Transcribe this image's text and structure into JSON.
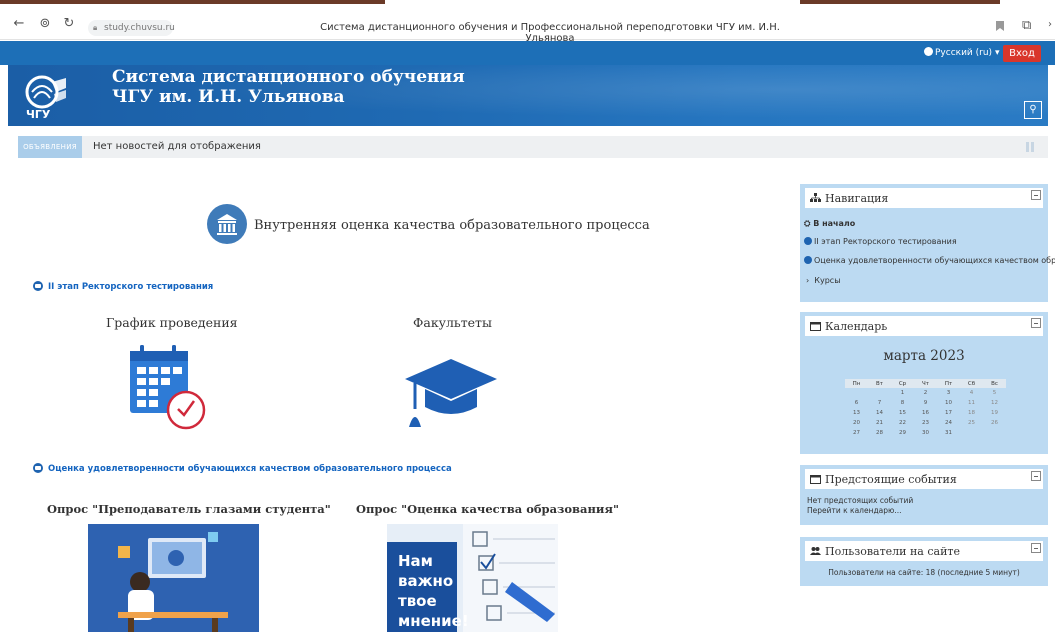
{
  "browser": {
    "url": "study.chuvsu.ru",
    "tab_title": "Система дистанционного обучения и Профессиональной переподготовки ЧГУ им. И.Н. Ульянова"
  },
  "topnav": {
    "language": "Русский (ru)",
    "login": "Вход"
  },
  "banner": {
    "title_line1": "Система дистанционного обучения",
    "title_line2": "ЧГУ им. И.Н. Ульянова",
    "logo_text": "ЧГУ"
  },
  "news": {
    "tag": "ОБЪЯВЛЕНИЯ",
    "text": "Нет новостей для отображения"
  },
  "main": {
    "heading": "Внутренняя оценка качества образовательного процесса",
    "section1": "II этап Ректорского тестирования",
    "schedule_title": "График проведения",
    "faculties_title": "Факультеты",
    "section2": "Оценка удовлетворенности обучающихся качеством образовательного процесса",
    "survey1_title": "Опрос \"Преподаватель глазами студента\"",
    "survey2_title": "Опрос \"Оценка качества образования\"",
    "survey2_image_text": [
      "Нам",
      "важно",
      "твое",
      "мнение!"
    ]
  },
  "navigation": {
    "title": "Навигация",
    "home": "В начало",
    "item1": "II этап Ректорского тестирования",
    "item2": "Оценка удовлетворенности обучающихся качеством обр...",
    "courses": "Курсы"
  },
  "calendar": {
    "title": "Календарь",
    "month": "марта 2023",
    "weekdays": [
      "Пн",
      "Вт",
      "Ср",
      "Чт",
      "Пт",
      "Сб",
      "Вс"
    ],
    "weeks": [
      [
        "",
        "",
        "1",
        "2",
        "3",
        "4",
        "5"
      ],
      [
        "6",
        "7",
        "8",
        "9",
        "10",
        "11",
        "12"
      ],
      [
        "13",
        "14",
        "15",
        "16",
        "17",
        "18",
        "19"
      ],
      [
        "20",
        "21",
        "22",
        "23",
        "24",
        "25",
        "26"
      ],
      [
        "27",
        "28",
        "29",
        "30",
        "31",
        "",
        ""
      ]
    ]
  },
  "events": {
    "title": "Предстоящие события",
    "none": "Нет предстоящих событий",
    "goto": "Перейти к календарю..."
  },
  "users": {
    "title": "Пользователи на сайте",
    "text": "Пользователи на сайте: 18 (последние 5 минут)"
  },
  "colors": {
    "topnav": "#1d6fb7",
    "login": "#d9362b",
    "block_bg": "#bcdaf2",
    "link": "#1565c0"
  }
}
